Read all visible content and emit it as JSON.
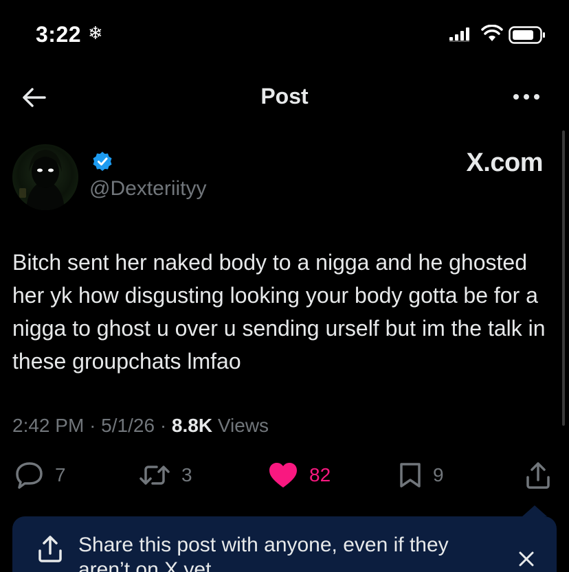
{
  "status_bar": {
    "time": "3:22",
    "snow_glyph": "❄"
  },
  "nav": {
    "title": "Post"
  },
  "post": {
    "handle": "@Dexteriityy",
    "watermark": "X.com",
    "text": "Bitch sent her naked body to a nigga and he ghosted her yk how disgusting looking your body gotta be for a nigga to ghost u over u sending urself but im the talk in these groupchats lmfao",
    "time": "2:42 PM",
    "date": "5/1/26",
    "views_count": "8.8K",
    "views_label": "Views",
    "separator": "·"
  },
  "actions": {
    "replies": "7",
    "reposts": "3",
    "likes": "82",
    "bookmarks": "9"
  },
  "share_banner": {
    "text": "Share this post with anyone, even if they aren’t on X yet"
  },
  "colors": {
    "like": "#f91880",
    "verified": "#1d9bf0",
    "muted": "#71767b",
    "banner": "#0c1e3f"
  }
}
